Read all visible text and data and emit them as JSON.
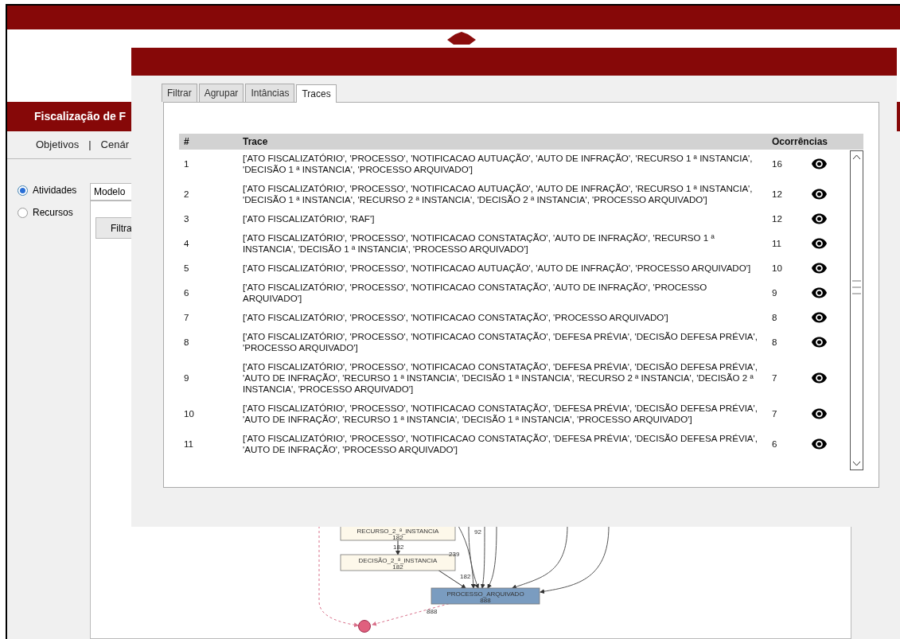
{
  "page": {
    "title": "Fiscalização de F",
    "nav": {
      "items": [
        "Objetivos",
        "Cenár"
      ],
      "separator": "|"
    },
    "view_options": [
      {
        "label": "Atividades",
        "selected": true
      },
      {
        "label": "Recursos",
        "selected": false
      }
    ],
    "model_field": {
      "value": "Modelo"
    },
    "filter_button": "Filtra",
    "diagram": {
      "nodes": [
        {
          "label": "RECURSO_2_ª_INSTANCIA",
          "count": "182",
          "kind": "activity"
        },
        {
          "label": "DECISÃO_2_ª_INSTANCIA",
          "count": "182",
          "kind": "activity"
        },
        {
          "label": "PROCESSO_ARQUIVADO",
          "count": "888",
          "kind": "end"
        }
      ],
      "edge_labels": [
        "182",
        "182",
        "239",
        "92",
        "888"
      ]
    }
  },
  "modal": {
    "tabs": [
      {
        "label": "Filtrar",
        "selected": false
      },
      {
        "label": "Agrupar",
        "selected": false
      },
      {
        "label": "Intâncias",
        "selected": false
      },
      {
        "label": "Traces",
        "selected": true
      }
    ],
    "table": {
      "columns": [
        "#",
        "Trace",
        "Ocorrências"
      ],
      "rows": [
        {
          "index": "1",
          "trace": "['ATO FISCALIZATÓRIO', 'PROCESSO', 'NOTIFICACAO AUTUAÇÃO', 'AUTO DE INFRAÇÃO', 'RECURSO 1 ª INSTANCIA', 'DECISÃO 1 ª INSTANCIA', 'PROCESSO ARQUIVADO']",
          "occurrences": "16"
        },
        {
          "index": "2",
          "trace": "['ATO FISCALIZATÓRIO', 'PROCESSO', 'NOTIFICACAO AUTUAÇÃO', 'AUTO DE INFRAÇÃO', 'RECURSO 1 ª INSTANCIA', 'DECISÃO 1 ª INSTANCIA', 'RECURSO 2 ª INSTANCIA', 'DECISÃO 2 ª INSTANCIA', 'PROCESSO ARQUIVADO']",
          "occurrences": "12"
        },
        {
          "index": "3",
          "trace": "['ATO FISCALIZATÓRIO', 'RAF']",
          "occurrences": "12"
        },
        {
          "index": "4",
          "trace": "['ATO FISCALIZATÓRIO', 'PROCESSO', 'NOTIFICACAO CONSTATAÇÃO', 'AUTO DE INFRAÇÃO', 'RECURSO 1 ª INSTANCIA', 'DECISÃO 1 ª INSTANCIA', 'PROCESSO ARQUIVADO']",
          "occurrences": "11"
        },
        {
          "index": "5",
          "trace": "['ATO FISCALIZATÓRIO', 'PROCESSO', 'NOTIFICACAO AUTUAÇÃO', 'AUTO DE INFRAÇÃO', 'PROCESSO ARQUIVADO']",
          "occurrences": "10"
        },
        {
          "index": "6",
          "trace": "['ATO FISCALIZATÓRIO', 'PROCESSO', 'NOTIFICACAO CONSTATAÇÃO', 'AUTO DE INFRAÇÃO', 'PROCESSO ARQUIVADO']",
          "occurrences": "9"
        },
        {
          "index": "7",
          "trace": "['ATO FISCALIZATÓRIO', 'PROCESSO', 'NOTIFICACAO CONSTATAÇÃO', 'PROCESSO ARQUIVADO']",
          "occurrences": "8"
        },
        {
          "index": "8",
          "trace": "['ATO FISCALIZATÓRIO', 'PROCESSO', 'NOTIFICACAO CONSTATAÇÃO', 'DEFESA PRÉVIA', 'DECISÃO DEFESA PRÉVIA', 'PROCESSO ARQUIVADO']",
          "occurrences": "8"
        },
        {
          "index": "9",
          "trace": "['ATO FISCALIZATÓRIO', 'PROCESSO', 'NOTIFICACAO CONSTATAÇÃO', 'DEFESA PRÉVIA', 'DECISÃO DEFESA PRÉVIA', 'AUTO DE INFRAÇÃO', 'RECURSO 1 ª INSTANCIA', 'DECISÃO 1 ª INSTANCIA', 'RECURSO 2 ª INSTANCIA', 'DECISÃO 2 ª INSTANCIA', 'PROCESSO ARQUIVADO']",
          "occurrences": "7"
        },
        {
          "index": "10",
          "trace": "['ATO FISCALIZATÓRIO', 'PROCESSO', 'NOTIFICACAO CONSTATAÇÃO', 'DEFESA PRÉVIA', 'DECISÃO DEFESA PRÉVIA', 'AUTO DE INFRAÇÃO', 'RECURSO 1 ª INSTANCIA', 'DECISÃO 1 ª INSTANCIA', 'PROCESSO ARQUIVADO']",
          "occurrences": "7"
        },
        {
          "index": "11",
          "trace": "['ATO FISCALIZATÓRIO', 'PROCESSO', 'NOTIFICACAO CONSTATAÇÃO', 'DEFESA PRÉVIA', 'DECISÃO DEFESA PRÉVIA', 'AUTO DE INFRAÇÃO', 'PROCESSO ARQUIVADO']",
          "occurrences": "6"
        }
      ]
    }
  }
}
